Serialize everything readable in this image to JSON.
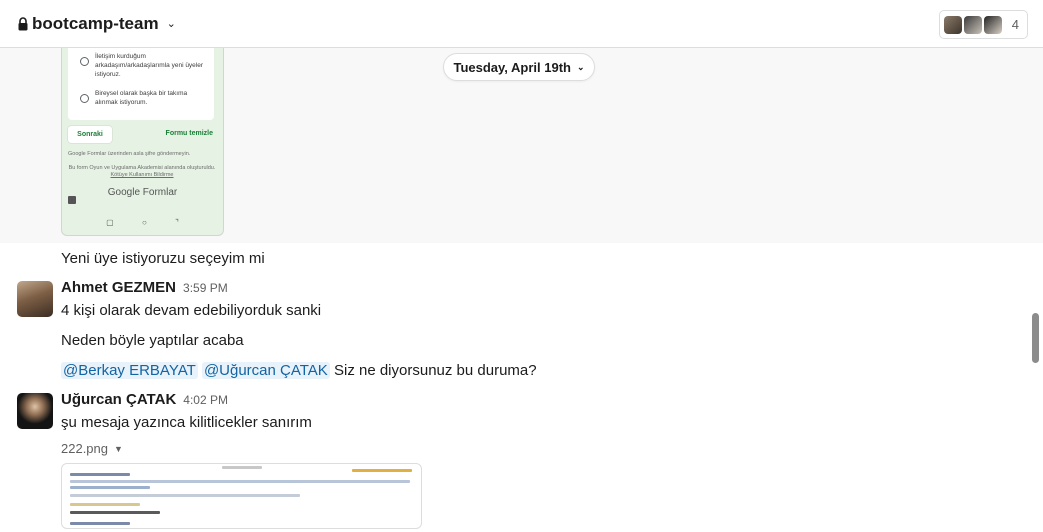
{
  "header": {
    "channel_name": "bootcamp-team",
    "member_count": "4",
    "lock_icon": "lock-icon",
    "chevron_icon": "chevron-down-icon"
  },
  "date_divider": {
    "label": "Tuesday, April 19th"
  },
  "form_screenshot": {
    "option_1": "İletişim kurduğum arkadaşım/arkadaşlarımla yeni üyeler istiyoruz.",
    "option_2": "Bireysel olarak başka bir takıma alınmak istiyorum.",
    "next_button": "Sonraki",
    "clear_form": "Formu temizle",
    "note_1": "Google Formlar üzerinden asla şifre göndermeyin.",
    "note_2": "Bu form Oyun ve Uygulama Akademisi alanında oluşturuldu.",
    "note_link": "Kötüye Kullanımı Bildirme",
    "brand": "Google Formlar"
  },
  "messages": {
    "continuation_1": "Yeni üye istiyoruzu seçeyim mi",
    "msg_ahmet": {
      "author": "Ahmet GEZMEN",
      "time": "3:59 PM",
      "line_1": "4 kişi olarak devam edebiliyorduk sanki",
      "line_2": "Neden böyle yaptılar acaba",
      "mention_1": "@Berkay ERBAYAT",
      "mention_2": "@Uğurcan ÇATAK",
      "line_3_rest": "Siz ne diyorsunuz bu duruma?"
    },
    "msg_ugurcan": {
      "author": "Uğurcan ÇATAK",
      "time": "4:02 PM",
      "line_1": "şu mesaja yazınca kilitlicekler sanırım",
      "file_name": "222.png"
    }
  },
  "colors": {
    "mention_bg": "#e8f2fa",
    "mention_text": "#1264a3",
    "form_green": "#1a7f37"
  }
}
